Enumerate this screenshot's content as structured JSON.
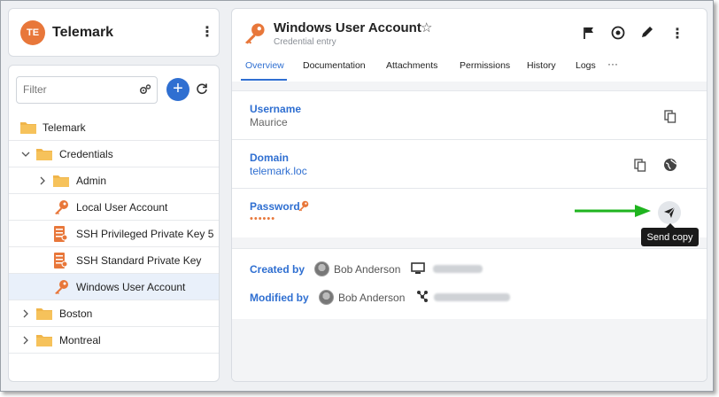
{
  "workspace": {
    "initials": "TE",
    "name": "Telemark",
    "avatar_color": "#e8773a"
  },
  "tree": {
    "filter_placeholder": "Filter",
    "items": [
      {
        "label": "Telemark",
        "icon": "folder-icon"
      },
      {
        "label": "Credentials",
        "icon": "folder-icon",
        "expanded": true
      },
      {
        "label": "Admin",
        "icon": "folder-icon",
        "expanded": false
      },
      {
        "label": "Local User Account",
        "icon": "key-icon"
      },
      {
        "label": "SSH Privileged Private Key 5",
        "icon": "ssh-key-icon"
      },
      {
        "label": "SSH Standard Private Key",
        "icon": "ssh-key-icon"
      },
      {
        "label": "Windows User Account",
        "icon": "key-icon",
        "selected": true
      },
      {
        "label": "Boston",
        "icon": "folder-icon",
        "expanded": false
      },
      {
        "label": "Montreal",
        "icon": "folder-icon",
        "expanded": false
      }
    ]
  },
  "entry": {
    "title": "Windows User Account",
    "subtitle": "Credential entry",
    "tabs": [
      {
        "label": "Overview",
        "active": true
      },
      {
        "label": "Documentation"
      },
      {
        "label": "Attachments"
      },
      {
        "label": "Permissions"
      },
      {
        "label": "History"
      },
      {
        "label": "Logs"
      }
    ],
    "tab_more": "···",
    "fields": {
      "username_label": "Username",
      "username_value": "Maurice",
      "domain_label": "Domain",
      "domain_value": "telemark.loc",
      "password_label": "Password",
      "password_value": "••••••"
    },
    "meta": {
      "created_label": "Created by",
      "created_user": "Bob Anderson",
      "modified_label": "Modified by",
      "modified_user": "Bob Anderson"
    },
    "tooltip": "Send copy"
  },
  "colors": {
    "accent": "#2f6fd1",
    "folder": "#f0b54a",
    "key": "#e8773a",
    "arrow": "#1fb41f"
  }
}
